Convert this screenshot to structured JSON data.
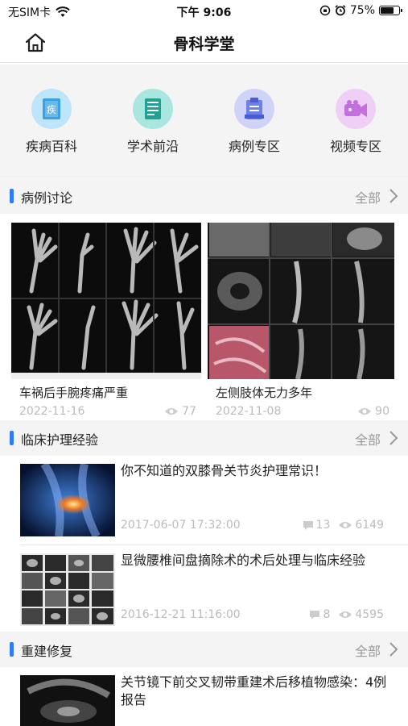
{
  "status": {
    "carrier": "无SIM卡",
    "time": "下午 9:06",
    "battery": "75%",
    "battery_level": 0.75
  },
  "nav": {
    "title": "骨科学堂"
  },
  "categories": [
    {
      "label": "疾病百科",
      "icon": "encyclopedia-book-icon",
      "color": "#8fcff5",
      "inner": "#3aa0e0"
    },
    {
      "label": "学术前沿",
      "icon": "academic-news-icon",
      "color": "#7fd8d0",
      "inner": "#26b3a5"
    },
    {
      "label": "病例专区",
      "icon": "case-clipboard-icon",
      "color": "#b9c0f5",
      "inner": "#6f7fe8"
    },
    {
      "label": "视频专区",
      "icon": "video-camera-icon",
      "color": "#e6b8f0",
      "inner": "#c36fe0"
    }
  ],
  "sections": {
    "case_discussion": {
      "title": "病例讨论",
      "more": "全部"
    },
    "nursing": {
      "title": "临床护理经验"
    },
    "reconstruction": {
      "title": "重建修复",
      "more": "全部"
    }
  },
  "nursing_more": "全部",
  "cases": [
    {
      "title": "车祸后手腕疼痛严重",
      "date": "2022-11-16",
      "views": "77"
    },
    {
      "title": "左侧肢体无力多年",
      "date": "2022-11-08",
      "views": "90"
    }
  ],
  "nursing_articles": [
    {
      "title": "你不知道的双膝骨关节炎护理常识！",
      "date": "2017-06-07 17:32:00",
      "comments": "13",
      "views": "6149"
    },
    {
      "title": "显微腰椎间盘摘除术的术后处理与临床经验",
      "date": "2016-12-21 11:16:00",
      "comments": "8",
      "views": "4595"
    }
  ],
  "reconstruction_articles": [
    {
      "title": "关节镜下前交叉韧带重建术后移植物感染：4例报告"
    }
  ]
}
